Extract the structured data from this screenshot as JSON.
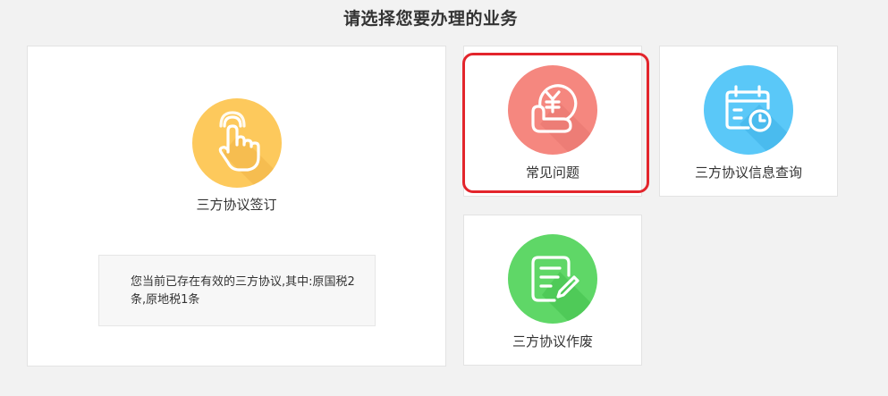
{
  "page": {
    "title": "请选择您要办理的业务"
  },
  "cards": {
    "sign": {
      "label": "三方协议签订",
      "icon": "hand-pointer-icon",
      "color": "#fdc95c",
      "info": "您当前已存在有效的三方协议,其中:原国税2条,原地税1条"
    },
    "faq": {
      "label": "常见问题",
      "icon": "yuan-coin-hand-icon",
      "color": "#f5877f",
      "highlighted": true
    },
    "query": {
      "label": "三方协议信息查询",
      "icon": "calendar-clock-icon",
      "color": "#5ac8f8"
    },
    "void": {
      "label": "三方协议作废",
      "icon": "document-pen-icon",
      "color": "#5fd767"
    }
  }
}
